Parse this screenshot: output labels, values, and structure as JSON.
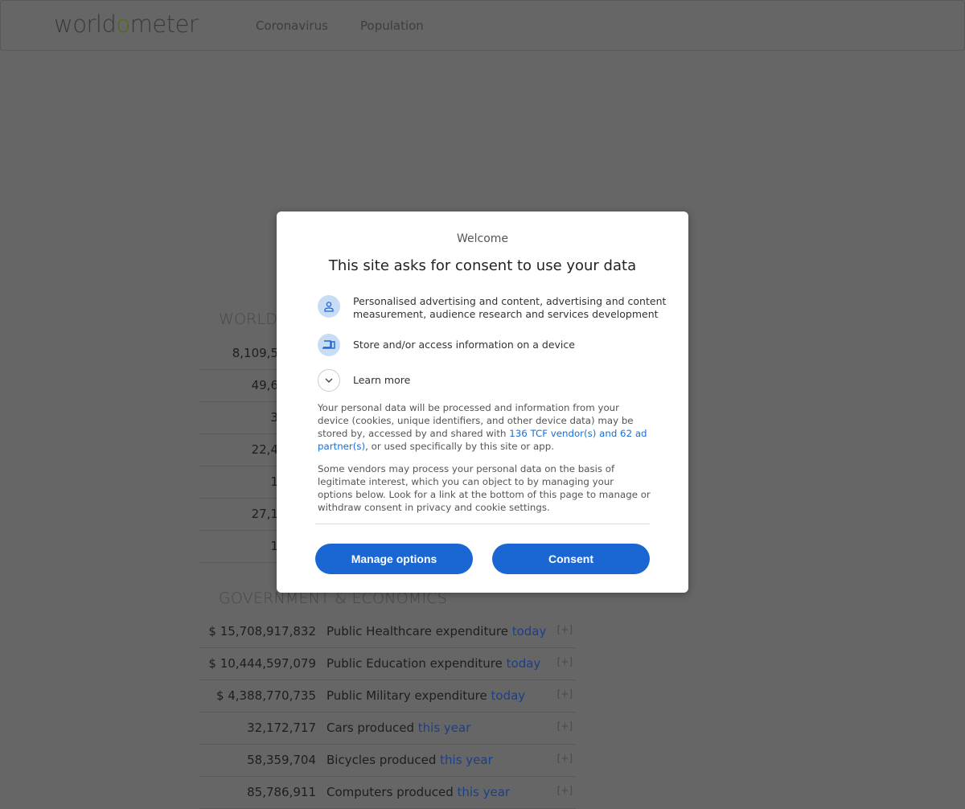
{
  "header": {
    "logo": {
      "pre": "world",
      "o": "o",
      "post": "meter"
    },
    "nav": [
      "Coronavirus",
      "Population"
    ]
  },
  "world": {
    "title": "WORLD",
    "rows": [
      "8,109,5",
      "49,6",
      "3",
      "22,4",
      "1",
      "27,1",
      "1"
    ]
  },
  "gov": {
    "title": "GOVERNMENT & ECONOMICS",
    "rows": [
      {
        "value": "$ 15,708,917,832",
        "label": "Public Healthcare expenditure",
        "period": "today"
      },
      {
        "value": "$ 10,444,597,079",
        "label": "Public Education expenditure",
        "period": "today"
      },
      {
        "value": "$ 4,388,770,735",
        "label": "Public Military expenditure",
        "period": "today"
      },
      {
        "value": "32,172,717",
        "label": "Cars produced",
        "period": "this year"
      },
      {
        "value": "58,359,704",
        "label": "Bicycles produced",
        "period": "this year"
      },
      {
        "value": "85,786,911",
        "label": "Computers produced",
        "period": "this year"
      }
    ],
    "expand": "[+]"
  },
  "consent": {
    "welcome": "Welcome",
    "title": "This site asks for consent to use your data",
    "items": [
      {
        "icon": "person-icon",
        "line1": "Personalised advertising and content, advertising and content",
        "line2": "measurement, audience research and services development"
      },
      {
        "icon": "devices-icon",
        "line1": "Store and/or access information on a device"
      },
      {
        "icon": "chevron-down-icon",
        "line1": "Learn more"
      }
    ],
    "p1_a": "Your personal data will be processed and information from your device (cookies, unique identifiers, and other device data) may be stored by, accessed by and shared with ",
    "p1_link": "136 TCF vendor(s) and 62 ad partner(s)",
    "p1_b": ", or used specifically by this site or app.",
    "p2": "Some vendors may process your personal data on the basis of legitimate interest, which you can object to by managing your options below. Look for a link at the bottom of this page to manage or withdraw consent in privacy and cookie settings.",
    "manage": "Manage options",
    "accept": "Consent",
    "accent": "#1a66d2"
  }
}
